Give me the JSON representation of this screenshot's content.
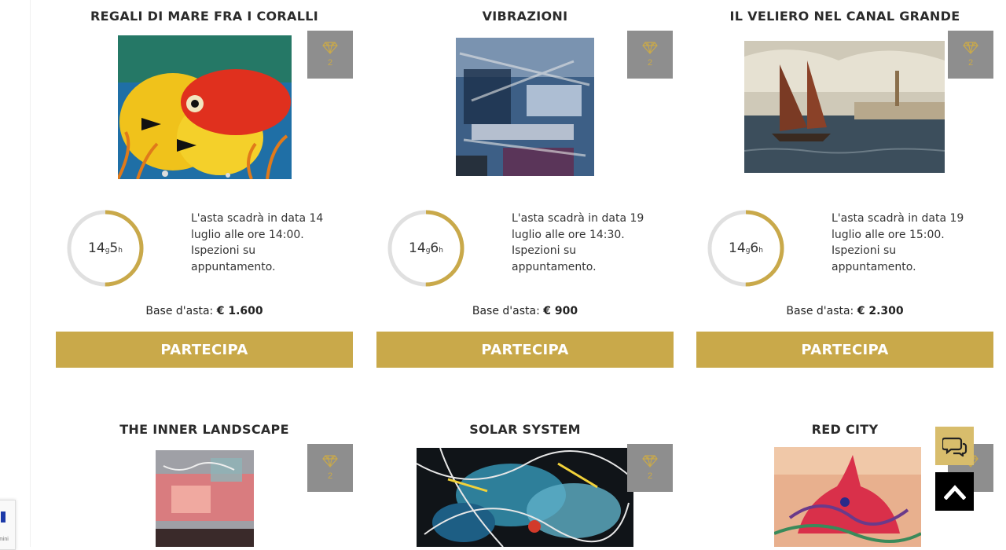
{
  "colors": {
    "accent": "#c9a94a",
    "badge_bg": "#8e8e8e",
    "ring_track": "#e0e0e0"
  },
  "lots": [
    {
      "title": "REGALI DI MARE FRA I CORALLI",
      "badge_icon": "diamond-icon",
      "badge_count": "2",
      "timer": {
        "days": "14",
        "day_unit": "g",
        "hours": "5",
        "hour_unit": "h",
        "progress": 0.5
      },
      "desc": [
        "L'asta scadrà in data 14",
        "luglio alle ore 14:00.",
        "Ispezioni su",
        "appuntamento."
      ],
      "base_label": "Base d'asta:",
      "base_value": "€ 1.600",
      "button": "PARTECIPA"
    },
    {
      "title": "VIBRAZIONI",
      "badge_icon": "diamond-icon",
      "badge_count": "2",
      "timer": {
        "days": "14",
        "day_unit": "g",
        "hours": "6",
        "hour_unit": "h",
        "progress": 0.5
      },
      "desc": [
        "L'asta scadrà in data 19",
        "luglio alle ore 14:30.",
        "Ispezioni su",
        "appuntamento."
      ],
      "base_label": "Base d'asta:",
      "base_value": "€ 900",
      "button": "PARTECIPA"
    },
    {
      "title": "IL VELIERO NEL CANAL GRANDE",
      "badge_icon": "diamond-icon",
      "badge_count": "2",
      "timer": {
        "days": "14",
        "day_unit": "g",
        "hours": "6",
        "hour_unit": "h",
        "progress": 0.5
      },
      "desc": [
        "L'asta scadrà in data 19",
        "luglio alle ore 15:00.",
        "Ispezioni su",
        "appuntamento."
      ],
      "base_label": "Base d'asta:",
      "base_value": "€ 2.300",
      "button": "PARTECIPA"
    },
    {
      "title": "THE INNER LANDSCAPE",
      "badge_icon": "diamond-icon",
      "badge_count": "2"
    },
    {
      "title": "SOLAR SYSTEM",
      "badge_icon": "diamond-icon",
      "badge_count": "2"
    },
    {
      "title": "RED CITY",
      "badge_icon": "diamond-icon",
      "badge_count": "2"
    }
  ],
  "floating": {
    "chat_icon": "chat-bubbles-icon",
    "top_icon": "chevron-up-icon"
  },
  "recaptcha": {
    "text": "mini"
  }
}
